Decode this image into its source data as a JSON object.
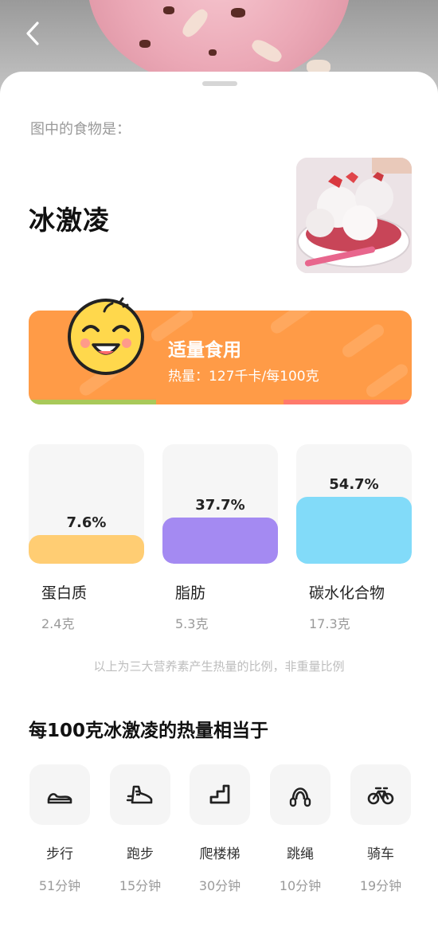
{
  "header": {
    "back_icon": "chevron-left-icon"
  },
  "result": {
    "caption": "图中的食物是：",
    "food_name": "冰激凌"
  },
  "banner": {
    "title": "适量食用",
    "calories_text": "热量：127千卡/每100克",
    "emoji": "smiling-face-icon",
    "background_color": "#ff9b47",
    "bar_colors": [
      "#a8c95a",
      "#ff9b47",
      "#ff7a6b"
    ]
  },
  "nutrients": [
    {
      "label": "蛋白质",
      "percent_text": "7.6%",
      "percent": 7.6,
      "grams": "2.4克",
      "color": "#ffcd73"
    },
    {
      "label": "脂肪",
      "percent_text": "37.7%",
      "percent": 37.7,
      "grams": "5.3克",
      "color": "#a48af2"
    },
    {
      "label": "碳水化合物",
      "percent_text": "54.7%",
      "percent": 54.7,
      "grams": "17.3克",
      "color": "#82dbf9"
    }
  ],
  "note": "以上为三大营养素产生热量的比例，非重量比例",
  "equivalent": {
    "title": "每100克冰激凌的热量相当于",
    "activities": [
      {
        "name": "步行",
        "time": "51分钟",
        "icon": "shoe-icon"
      },
      {
        "name": "跑步",
        "time": "15分钟",
        "icon": "running-shoe-icon"
      },
      {
        "name": "爬楼梯",
        "time": "30分钟",
        "icon": "stairs-icon"
      },
      {
        "name": "跳绳",
        "time": "10分钟",
        "icon": "jump-rope-icon"
      },
      {
        "name": "骑车",
        "time": "19分钟",
        "icon": "bicycle-icon"
      }
    ]
  }
}
